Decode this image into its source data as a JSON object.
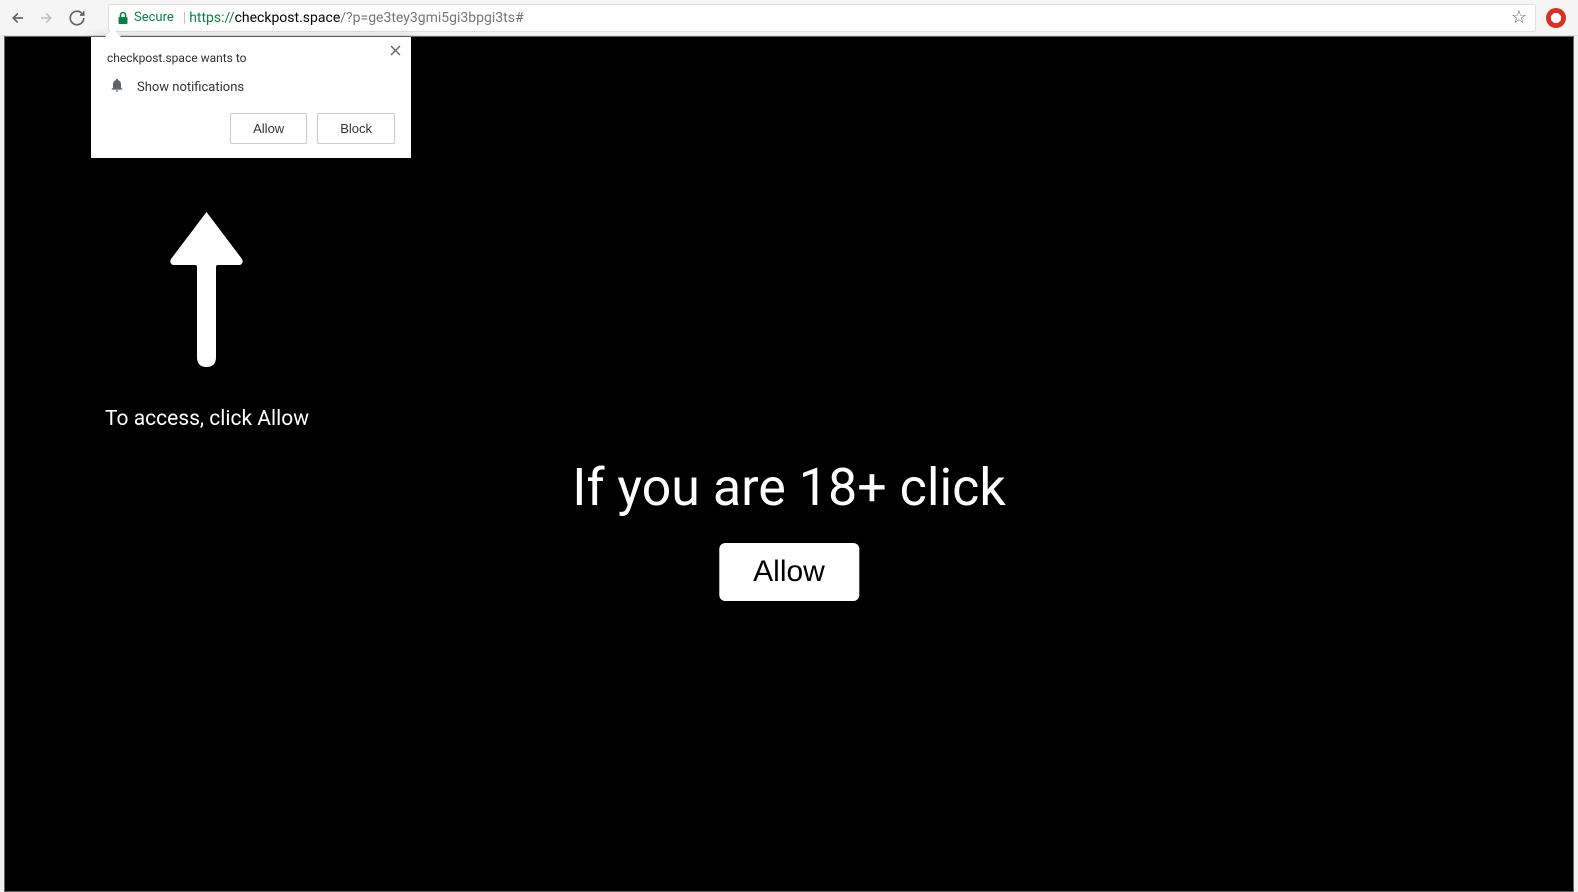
{
  "browser": {
    "secure_label": "Secure",
    "url_scheme": "https://",
    "url_host": "checkpost.space",
    "url_path": "/?p=ge3tey3gmi5gi3bpgi3ts#"
  },
  "notification_popup": {
    "header": "checkpost.space wants to",
    "body_text": "Show notifications",
    "allow_label": "Allow",
    "block_label": "Block"
  },
  "page": {
    "instruction_text": "To access, click Allow",
    "center_heading": "If you are 18+ click",
    "center_button": "Allow"
  }
}
